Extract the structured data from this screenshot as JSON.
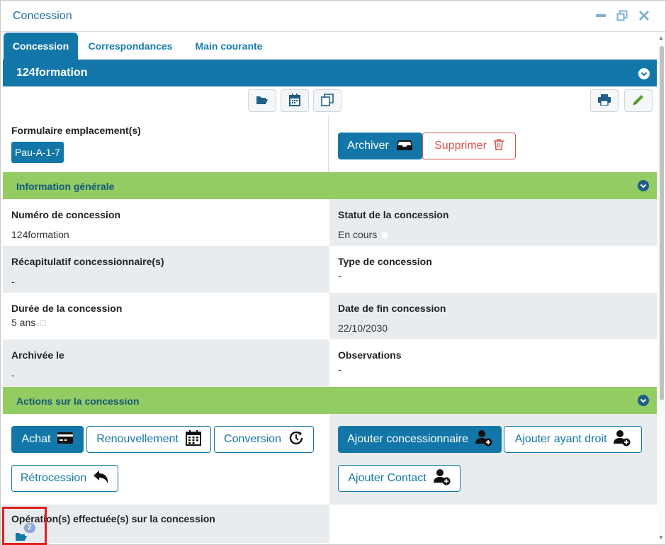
{
  "window": {
    "title": "Concession"
  },
  "tabs": [
    {
      "label": "Concession"
    },
    {
      "label": "Correspondances"
    },
    {
      "label": "Main courante"
    }
  ],
  "header": {
    "name": "124formation"
  },
  "form": {
    "emplacement_label": "Formulaire emplacement(s)",
    "emplacement_tag": "Pau-A-1-7",
    "archive_label": "Archiver",
    "delete_label": "Supprimer"
  },
  "general": {
    "section_title": "Information générale",
    "numero_label": "Numéro de concession",
    "numero_value": "124formation",
    "statut_label": "Statut de la concession",
    "statut_value": "En cours",
    "recap_label": "Récapitulatif concessionnaire(s)",
    "recap_value": "-",
    "type_label": "Type de concession",
    "type_value": "-",
    "duree_label": "Durée de la concession",
    "duree_value": "5 ans",
    "datefin_label": "Date de fin concession",
    "datefin_value": "22/10/2030",
    "archive_label": "Archivée le",
    "archive_value": "-",
    "obs_label": "Observations",
    "obs_value": "-"
  },
  "actions": {
    "section_title": "Actions sur la concession",
    "achat": "Achat",
    "renouvellement": "Renouvellement",
    "conversion": "Conversion",
    "retrocession": "Rétrocession",
    "ajouter_concessionnaire": "Ajouter concessionnaire",
    "ajouter_ayant_droit": "Ajouter ayant droit",
    "ajouter_contact": "Ajouter Contact"
  },
  "operations": {
    "label": "Opération(s) effectuée(s) sur la concession",
    "count": "2"
  },
  "colors": {
    "primary": "#1277a8",
    "green": "#92cc62",
    "danger": "#d9534f",
    "highlight": "#e0201c"
  }
}
